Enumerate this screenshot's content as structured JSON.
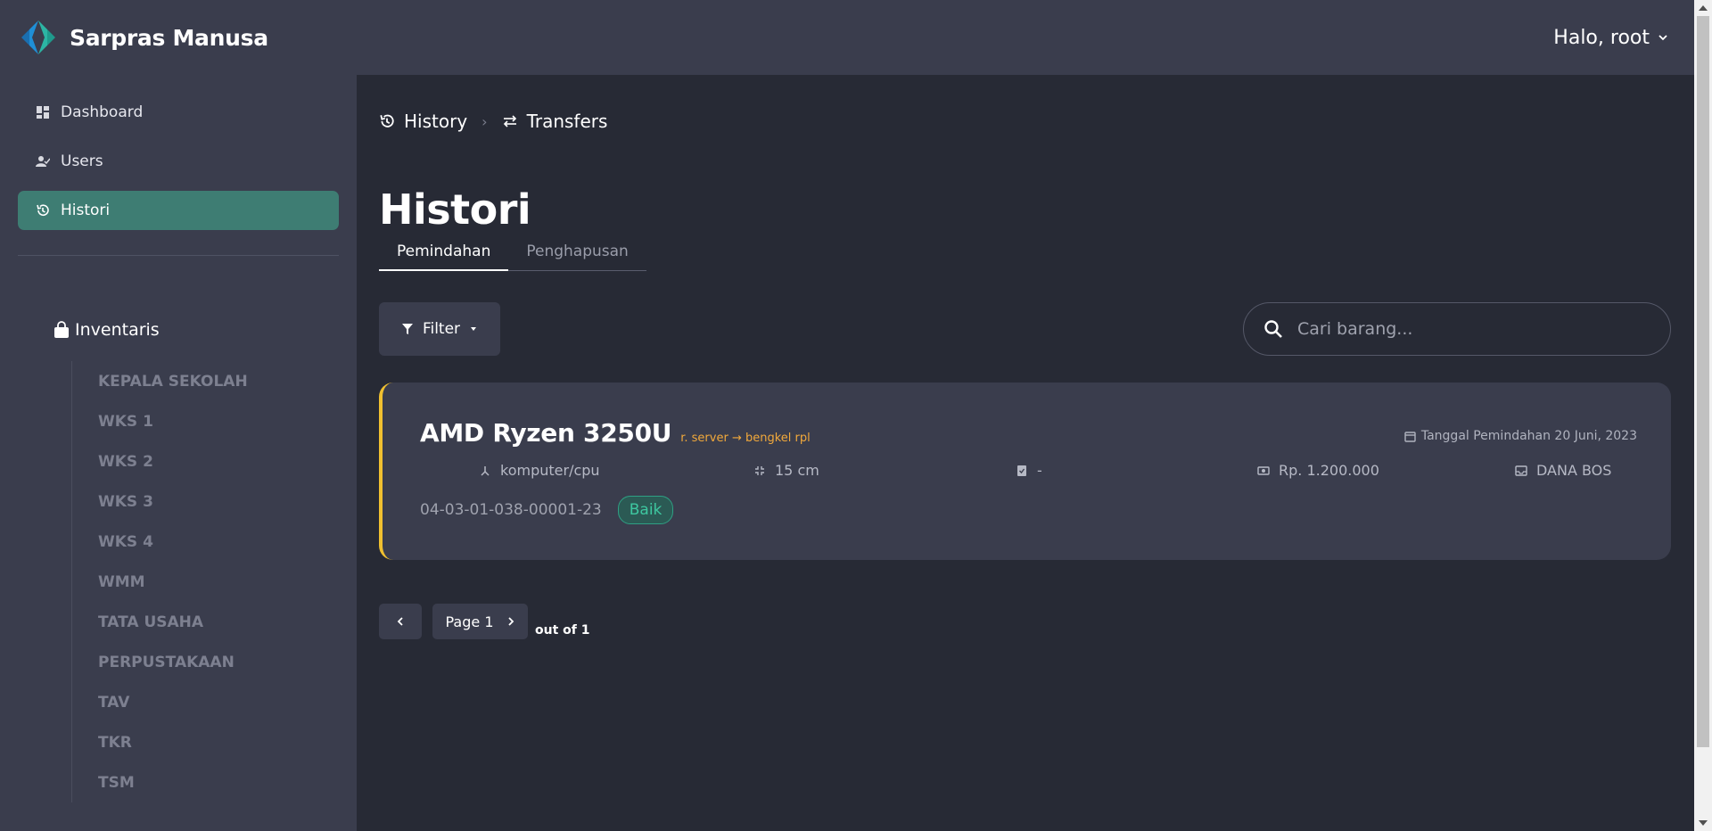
{
  "brand": {
    "name": "Sarpras Manusa"
  },
  "user": {
    "greeting": "Halo, root"
  },
  "sidebar": {
    "nav": [
      {
        "label": "Dashboard",
        "icon": "dashboard-icon"
      },
      {
        "label": "Users",
        "icon": "user-check-icon"
      },
      {
        "label": "Histori",
        "icon": "history-icon",
        "active": true
      }
    ],
    "inventory_heading": "Inventaris",
    "inventory_items": [
      "KEPALA SEKOLAH",
      "WKS 1",
      "WKS 2",
      "WKS 3",
      "WKS 4",
      "WMM",
      "TATA USAHA",
      "PERPUSTAKAAN",
      "TAV",
      "TKR",
      "TSM"
    ]
  },
  "breadcrumb": {
    "first": "History",
    "second": "Transfers"
  },
  "page": {
    "title": "Histori"
  },
  "tabs": [
    "Pemindahan",
    "Penghapusan"
  ],
  "toolbar": {
    "filter_label": "Filter",
    "search_placeholder": "Cari barang..."
  },
  "card": {
    "title": "AMD Ryzen 3250U",
    "route_from": "r. server",
    "route_to": "bengkel rpl",
    "date": "Tanggal Pemindahan 20 Juni, 2023",
    "category": "komputer/cpu",
    "size": "15 cm",
    "document": "-",
    "price": "Rp. 1.200.000",
    "fund": "DANA BOS",
    "code": "04-03-01-038-00001-23",
    "condition": "Baik"
  },
  "pager": {
    "page_label": "Page 1",
    "out_of": "out of 1"
  },
  "colors": {
    "accent": "#3e7d73",
    "card_border": "#f0c030",
    "route": "#f2a93b",
    "badge": "#3ec7a0"
  }
}
